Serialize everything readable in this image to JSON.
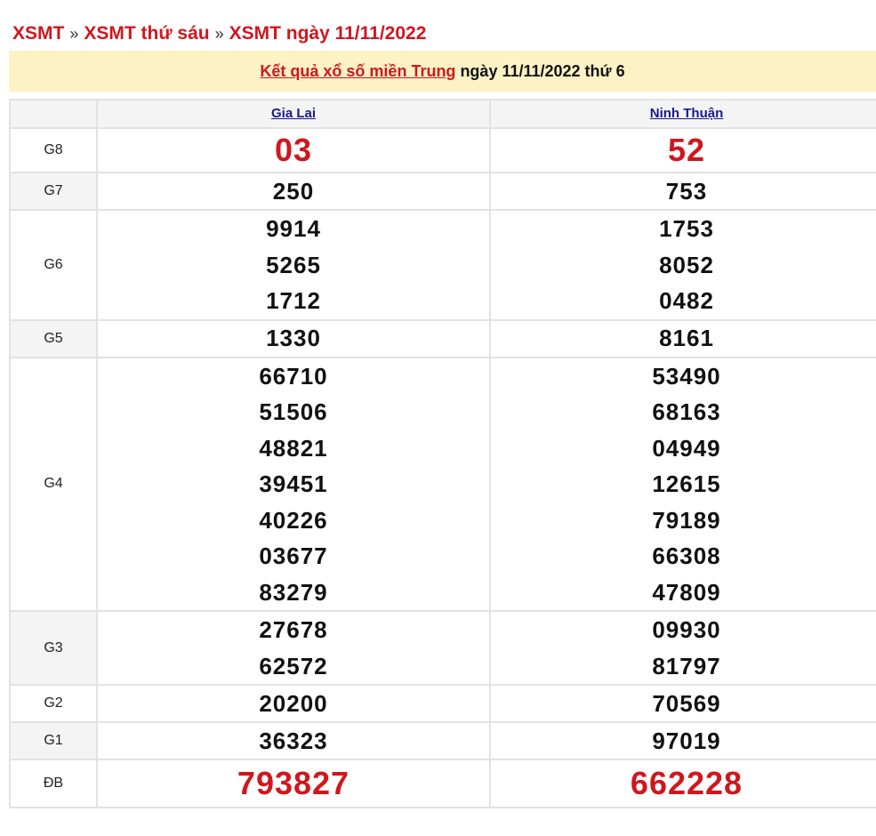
{
  "breadcrumb": {
    "item1": "XSMT",
    "sep1": "»",
    "item2": "XSMT thứ sáu",
    "sep2": "»",
    "item3": "XSMT ngày 11/11/2022"
  },
  "banner": {
    "link_text": "Kết quả xổ số miền Trung",
    "rest_text": "ngày 11/11/2022 thứ 6"
  },
  "table": {
    "provinces": [
      "Gia Lai",
      "Ninh Thuận"
    ],
    "rows": {
      "g8": {
        "label": "G8",
        "gia_lai": [
          "03"
        ],
        "ninh_thuan": [
          "52"
        ]
      },
      "g7": {
        "label": "G7",
        "gia_lai": [
          "250"
        ],
        "ninh_thuan": [
          "753"
        ]
      },
      "g6": {
        "label": "G6",
        "gia_lai": [
          "9914",
          "5265",
          "1712"
        ],
        "ninh_thuan": [
          "1753",
          "8052",
          "0482"
        ]
      },
      "g5": {
        "label": "G5",
        "gia_lai": [
          "1330"
        ],
        "ninh_thuan": [
          "8161"
        ]
      },
      "g4": {
        "label": "G4",
        "gia_lai": [
          "66710",
          "51506",
          "48821",
          "39451",
          "40226",
          "03677",
          "83279"
        ],
        "ninh_thuan": [
          "53490",
          "68163",
          "04949",
          "12615",
          "79189",
          "66308",
          "47809"
        ]
      },
      "g3": {
        "label": "G3",
        "gia_lai": [
          "27678",
          "62572"
        ],
        "ninh_thuan": [
          "09930",
          "81797"
        ]
      },
      "g2": {
        "label": "G2",
        "gia_lai": [
          "20200"
        ],
        "ninh_thuan": [
          "70569"
        ]
      },
      "g1": {
        "label": "G1",
        "gia_lai": [
          "36323"
        ],
        "ninh_thuan": [
          "97019"
        ]
      },
      "db": {
        "label": "ĐB",
        "gia_lai": [
          "793827"
        ],
        "ninh_thuan": [
          "662228"
        ]
      }
    }
  },
  "colors": {
    "accent_red": "#d0171d",
    "banner_bg": "#fcf2c4",
    "link_blue": "#1a1a8c",
    "border_gray": "#e2e2e2"
  }
}
